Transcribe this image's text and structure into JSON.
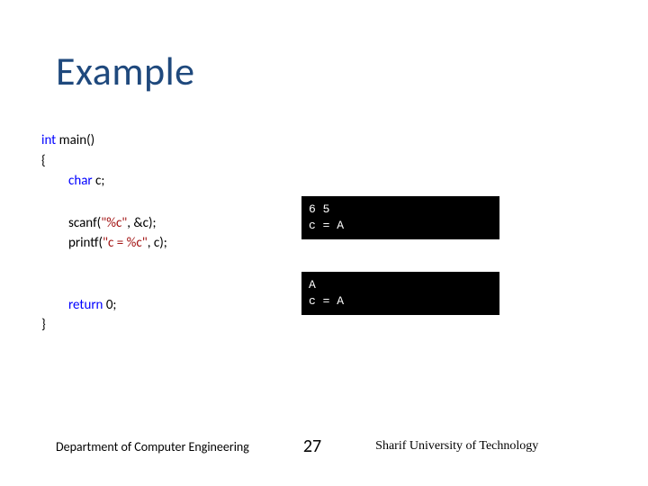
{
  "title": "Example",
  "code": {
    "line1_kw": "int",
    "line1_rest": " main()",
    "line2": "{",
    "line3_kw": "char",
    "line3_rest": " c;",
    "line4a": "scanf(",
    "line4b": "\"%c\"",
    "line4c": ", &c);",
    "line5a": "printf(",
    "line5b": "\"c = %c\"",
    "line5c": ", c);",
    "line6_kw": "return",
    "line6_rest": " 0;",
    "line7": "}"
  },
  "console1": {
    "row1": "6 5",
    "row2": "c = A"
  },
  "console2": {
    "row1": "A",
    "row2": "c = A"
  },
  "footer": {
    "dept": "Department of Computer Engineering",
    "page": "27",
    "sharif": "Sharif University of Technology"
  }
}
